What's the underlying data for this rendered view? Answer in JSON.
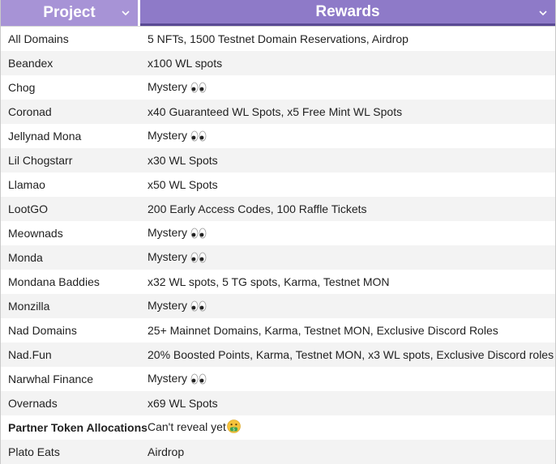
{
  "header": {
    "project_label": "Project",
    "rewards_label": "Rewards"
  },
  "rows": [
    {
      "project": "All Domains",
      "reward": "5 NFTs, 1500 Testnet Domain Reservations, Airdrop",
      "emoji": ""
    },
    {
      "project": "Beandex",
      "reward": "x100 WL spots",
      "emoji": ""
    },
    {
      "project": "Chog",
      "reward": "Mystery",
      "emoji": "eyes"
    },
    {
      "project": "Coronad",
      "reward": "x40 Guaranteed WL Spots, x5 Free Mint WL Spots",
      "emoji": ""
    },
    {
      "project": "Jellynad Mona",
      "reward": "Mystery",
      "emoji": "eyes"
    },
    {
      "project": "Lil Chogstarr",
      "reward": "x30 WL Spots",
      "emoji": ""
    },
    {
      "project": "Llamao",
      "reward": "x50 WL Spots",
      "emoji": ""
    },
    {
      "project": "LootGO",
      "reward": "200 Early Access Codes, 100 Raffle Tickets",
      "emoji": ""
    },
    {
      "project": "Meownads",
      "reward": "Mystery",
      "emoji": "eyes"
    },
    {
      "project": "Monda",
      "reward": "Mystery",
      "emoji": "eyes"
    },
    {
      "project": "Mondana Baddies",
      "reward": "x32 WL spots, 5 TG spots, Karma, Testnet MON",
      "emoji": ""
    },
    {
      "project": "Monzilla",
      "reward": "Mystery",
      "emoji": "eyes"
    },
    {
      "project": "Nad Domains",
      "reward": "25+ Mainnet Domains, Karma, Testnet MON, Exclusive Discord Roles",
      "emoji": ""
    },
    {
      "project": "Nad.Fun",
      "reward": "20% Boosted Points, Karma, Testnet MON, x3 WL spots, Exclusive Discord roles",
      "emoji": ""
    },
    {
      "project": "Narwhal Finance",
      "reward": "Mystery",
      "emoji": "eyes"
    },
    {
      "project": "Overnads",
      "reward": "x69 WL Spots",
      "emoji": ""
    },
    {
      "project": "Partner Token Allocations",
      "reward": "Can't reveal yet",
      "emoji": "money-mouth",
      "bold": true
    },
    {
      "project": "Plato Eats",
      "reward": "Airdrop",
      "emoji": ""
    }
  ]
}
